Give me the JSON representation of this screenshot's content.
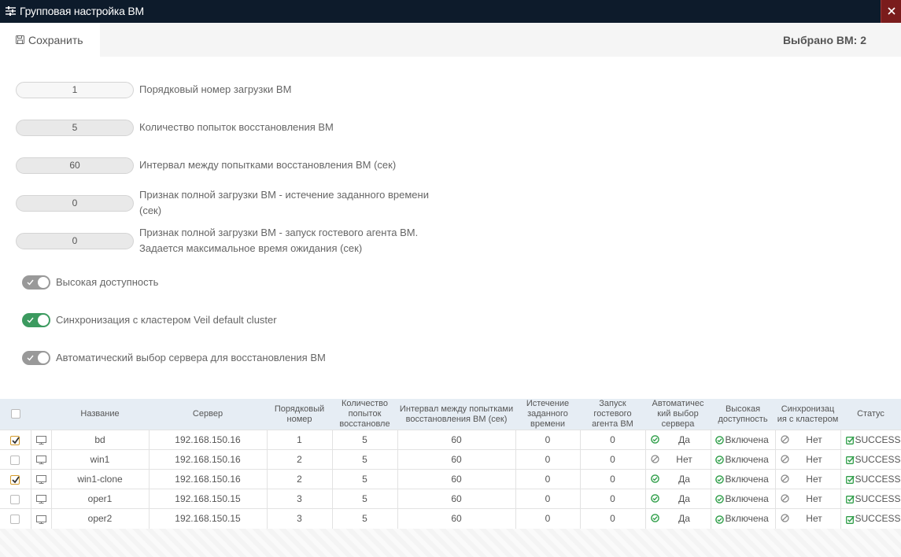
{
  "window": {
    "title": "Групповая настройка ВМ"
  },
  "toolbar": {
    "save_label": "Сохранить",
    "selected_count": "Выбрано ВМ: 2"
  },
  "fields": [
    {
      "value": "1",
      "label": "Порядковый номер загрузки ВМ"
    },
    {
      "value": "5",
      "label": "Количество попыток восстановления ВМ"
    },
    {
      "value": "60",
      "label": "Интервал между попытками восстановления ВМ (сек)"
    },
    {
      "value": "0",
      "label_line1": "Признак полной загрузки ВМ - истечение заданного времени",
      "label_line2": "(сек)"
    },
    {
      "value": "0",
      "label_line1": "Признак полной загрузки ВМ - запуск гостевого агента ВМ.",
      "label_line2": "Задается максимальное время ожидания (сек)"
    }
  ],
  "toggles": [
    {
      "label": "Высокая доступность",
      "state": "off"
    },
    {
      "label": "Синхронизация с кластером Veil default cluster",
      "state": "on"
    },
    {
      "label": "Автоматический выбор сервера для восстановления ВМ",
      "state": "off"
    }
  ],
  "table": {
    "headers": {
      "name": "Название",
      "server": "Сервер",
      "order": "Порядковый номер",
      "attempts": "Количество попыток восстановле",
      "interval": "Интервал между попытками восстановления ВМ (сек)",
      "expire": "Истечение заданного времени",
      "agent": "Запуск гостевого агента ВМ",
      "auto": "Автоматичес кий выбор сервера",
      "ha": "Высокая доступность",
      "sync": "Синхронизац ия с кластером",
      "status": "Статус"
    },
    "rows": [
      {
        "checked": true,
        "name": "bd",
        "server": "192.168.150.16",
        "order": "1",
        "attempts": "5",
        "interval": "60",
        "expire": "0",
        "agent": "0",
        "auto": "Да",
        "ha": "Включена",
        "sync": "Нет",
        "status": "SUCCESS"
      },
      {
        "checked": false,
        "name": "win1",
        "server": "192.168.150.16",
        "order": "2",
        "attempts": "5",
        "interval": "60",
        "expire": "0",
        "agent": "0",
        "auto": "Нет",
        "ha": "Включена",
        "sync": "Нет",
        "status": "SUCCESS"
      },
      {
        "checked": true,
        "name": "win1-clone",
        "server": "192.168.150.16",
        "order": "2",
        "attempts": "5",
        "interval": "60",
        "expire": "0",
        "agent": "0",
        "auto": "Да",
        "ha": "Включена",
        "sync": "Нет",
        "status": "SUCCESS"
      },
      {
        "checked": false,
        "name": "oper1",
        "server": "192.168.150.15",
        "order": "3",
        "attempts": "5",
        "interval": "60",
        "expire": "0",
        "agent": "0",
        "auto": "Да",
        "ha": "Включена",
        "sync": "Нет",
        "status": "SUCCESS"
      },
      {
        "checked": false,
        "name": "oper2",
        "server": "192.168.150.15",
        "order": "3",
        "attempts": "5",
        "interval": "60",
        "expire": "0",
        "agent": "0",
        "auto": "Да",
        "ha": "Включена",
        "sync": "Нет",
        "status": "SUCCESS"
      }
    ]
  },
  "colors": {
    "titlebar": "#0d1b2b",
    "toggle_on": "#3c9a5f",
    "toggle_off": "#999999",
    "ok_green": "#2e9e48",
    "checkbox_accent": "#d49a2a"
  },
  "icons": {
    "title": "sliders-icon",
    "close": "close-icon",
    "save": "floppy-disk-icon",
    "vm": "monitor-icon",
    "yes": "check-circle-icon",
    "no": "ban-icon",
    "status": "check-square-icon"
  }
}
